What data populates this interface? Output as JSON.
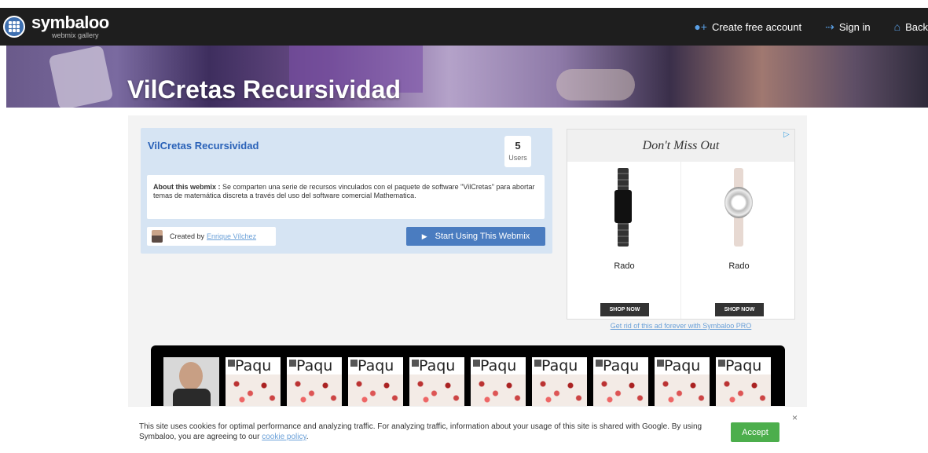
{
  "header": {
    "logo_name": "symbaloo",
    "logo_sub": "webmix gallery",
    "nav": [
      {
        "label": "Create free account",
        "icon": "user-plus-icon"
      },
      {
        "label": "Sign in",
        "icon": "sign-in-icon"
      },
      {
        "label": "Back",
        "icon": "home-icon"
      }
    ]
  },
  "banner": {
    "title": "VilCretas Recursividad"
  },
  "webmix": {
    "title": "VilCretas Recursividad",
    "users_count": "5",
    "users_label": "Users",
    "about_label": "About this webmix :",
    "about_text": " Se comparten una serie de recursos vinculados con el paquete de software \"VilCretas\" para abortar temas de matemática discreta a través del uso del software comercial Mathematica.",
    "created_by_label": "Created by",
    "creator_name": "Enrique Vílchez",
    "start_button": "Start Using This Webmix"
  },
  "ad": {
    "headline": "Don't Miss Out",
    "products": [
      {
        "brand": "Rado",
        "cta": "SHOP NOW"
      },
      {
        "brand": "Rado",
        "cta": "SHOP NOW"
      }
    ],
    "remove_ad": "Get rid of this ad forever with Symbaloo PRO"
  },
  "tiles": {
    "label": "Paqu",
    "count": 9
  },
  "cookie": {
    "text": "This site uses cookies for optimal performance and analyzing traffic. For analyzing traffic, information about your usage of this site is shared with Google. By using Symbaloo, you are agreeing to our ",
    "link": "cookie policy",
    "end": ".",
    "accept": "Accept",
    "close": "×"
  },
  "colors": {
    "navbar": "#1e1e1e",
    "accent": "#4a7cc0",
    "accept": "#4cae4c",
    "card": "#d6e4f3"
  }
}
